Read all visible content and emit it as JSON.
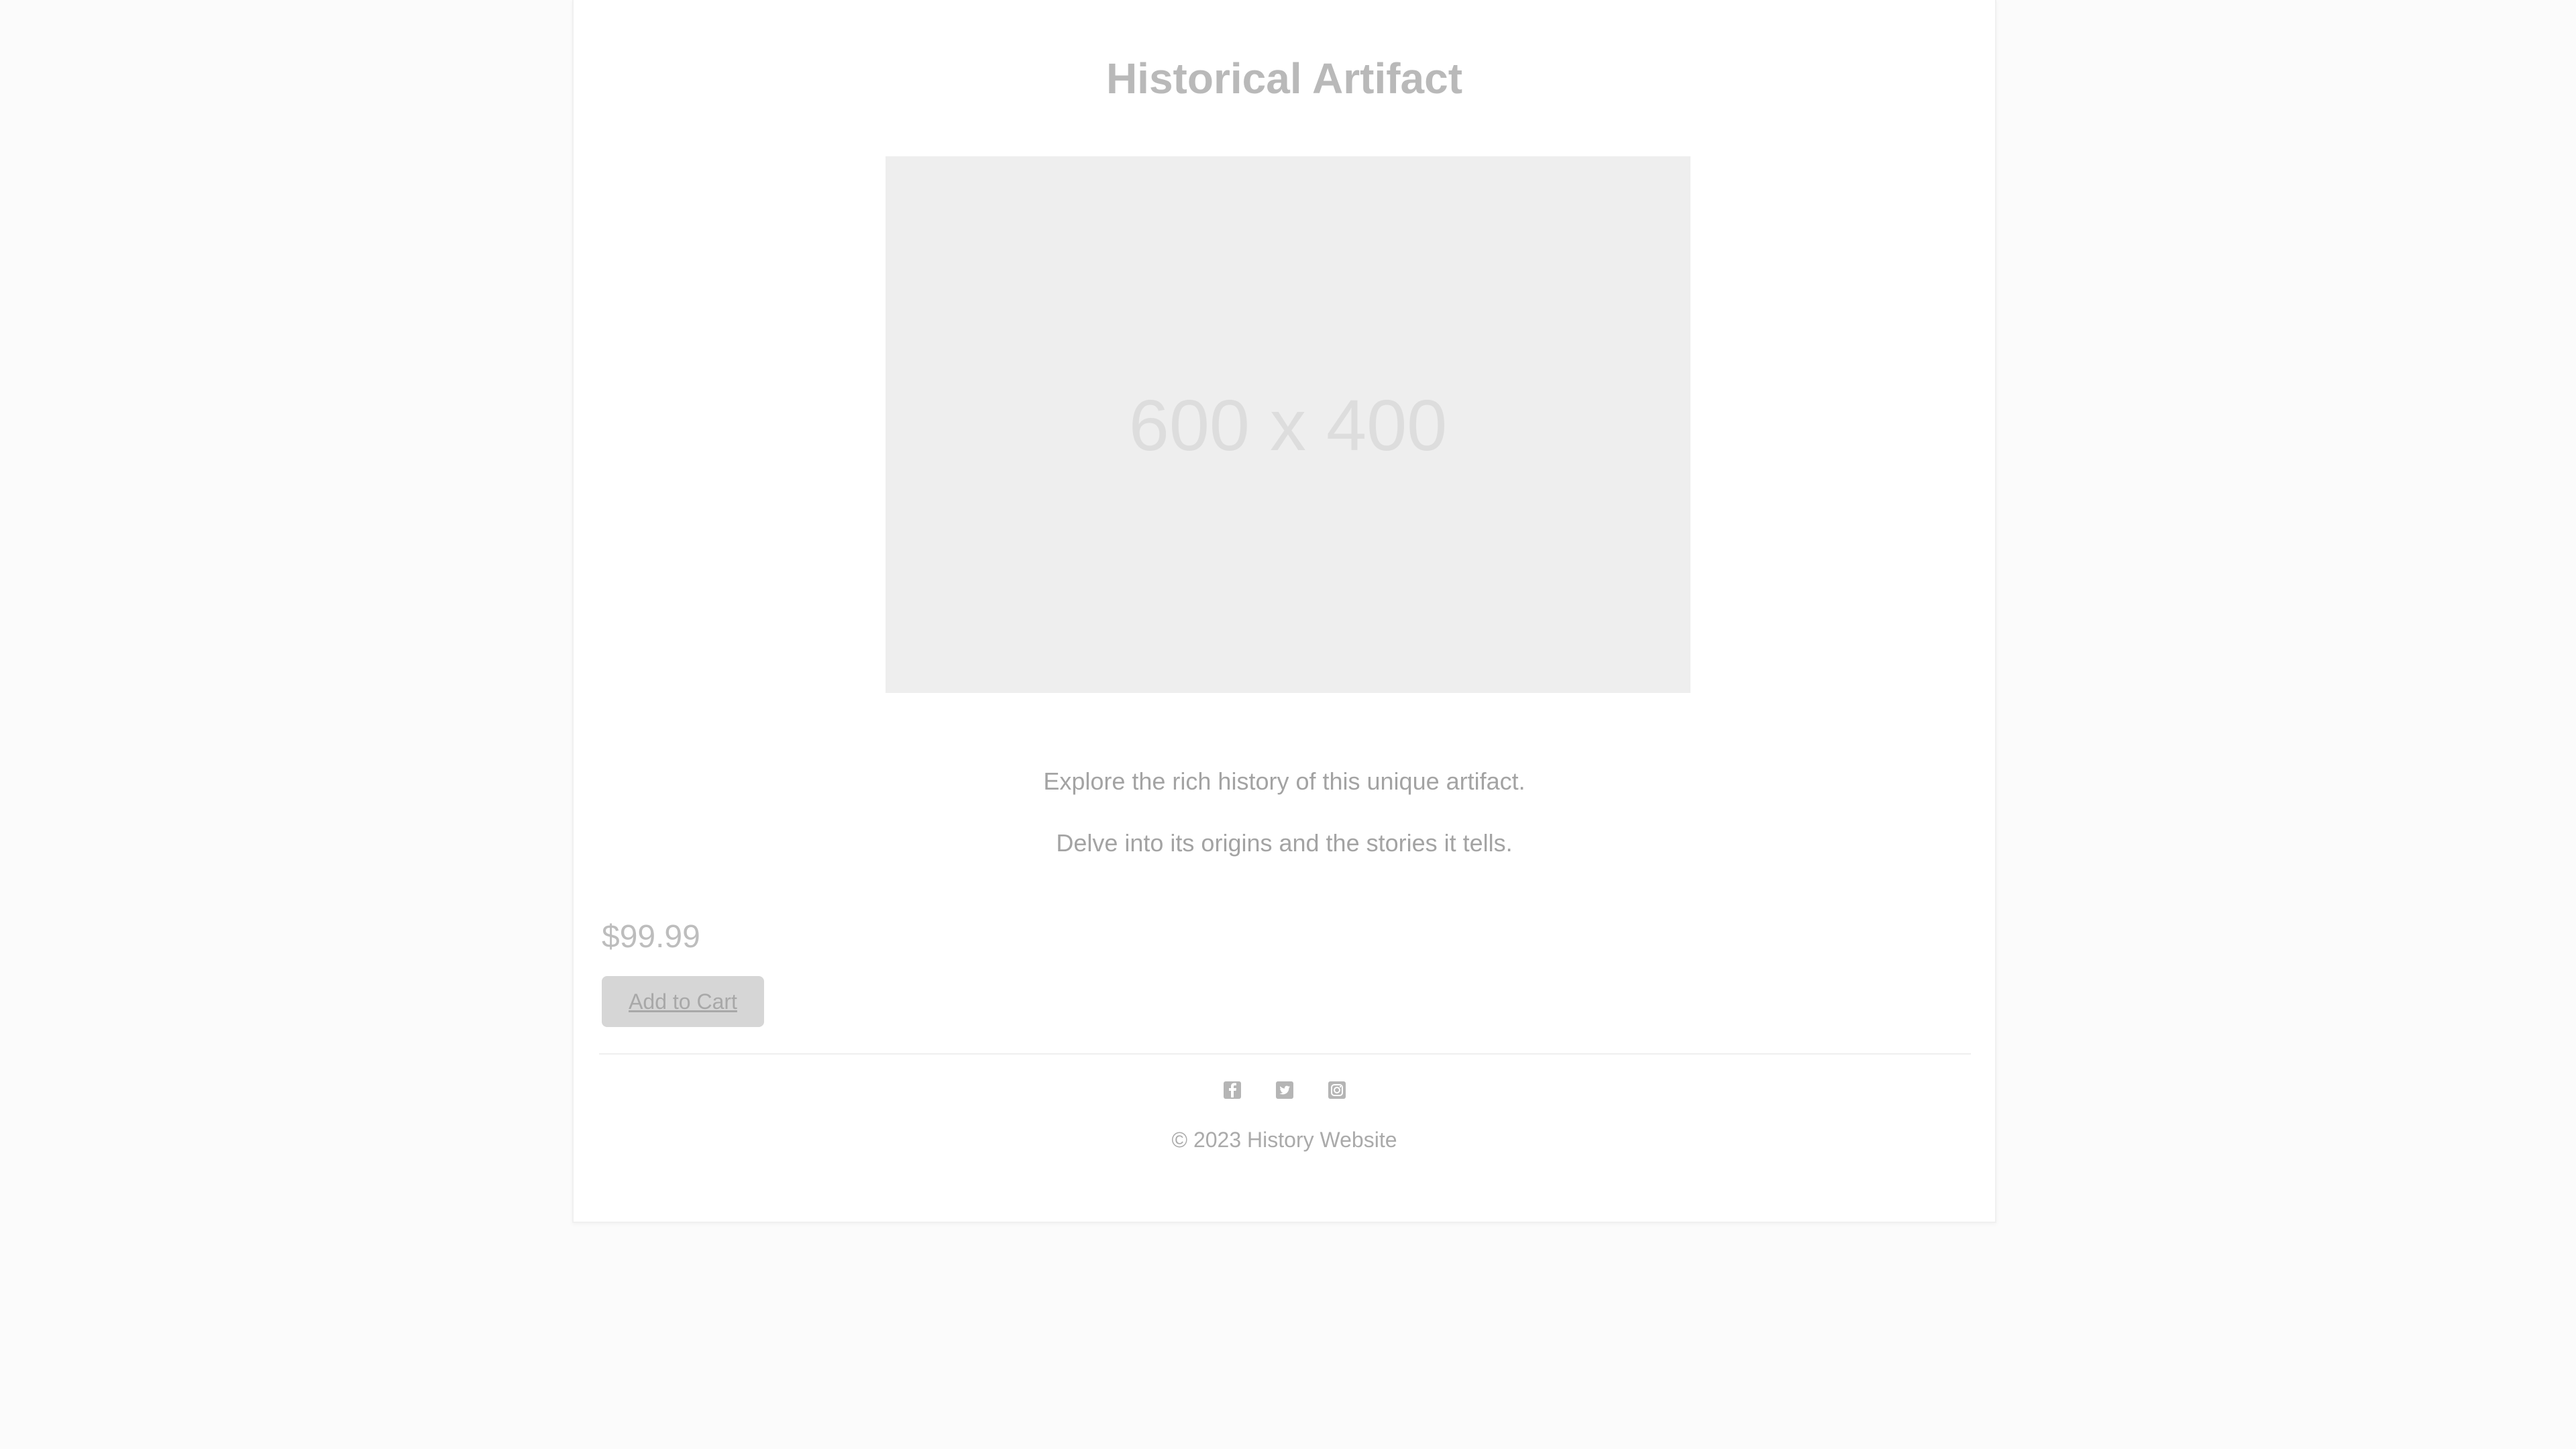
{
  "product": {
    "title": "Historical Artifact",
    "image_label": "600 x 400",
    "description_lines": [
      "Explore the rich history of this unique artifact.",
      "Delve into its origins and the stories it tells."
    ],
    "price": "$99.99",
    "add_to_cart_label": "Add to Cart"
  },
  "footer": {
    "social_icons": [
      "facebook-icon",
      "twitter-icon",
      "instagram-icon"
    ],
    "copyright": "© 2023 History Website"
  },
  "colors": {
    "page_background": "#fbfbfb",
    "card_background": "#ffffff",
    "image_placeholder": "#eeeeee",
    "button_background": "#d6d6d6"
  }
}
